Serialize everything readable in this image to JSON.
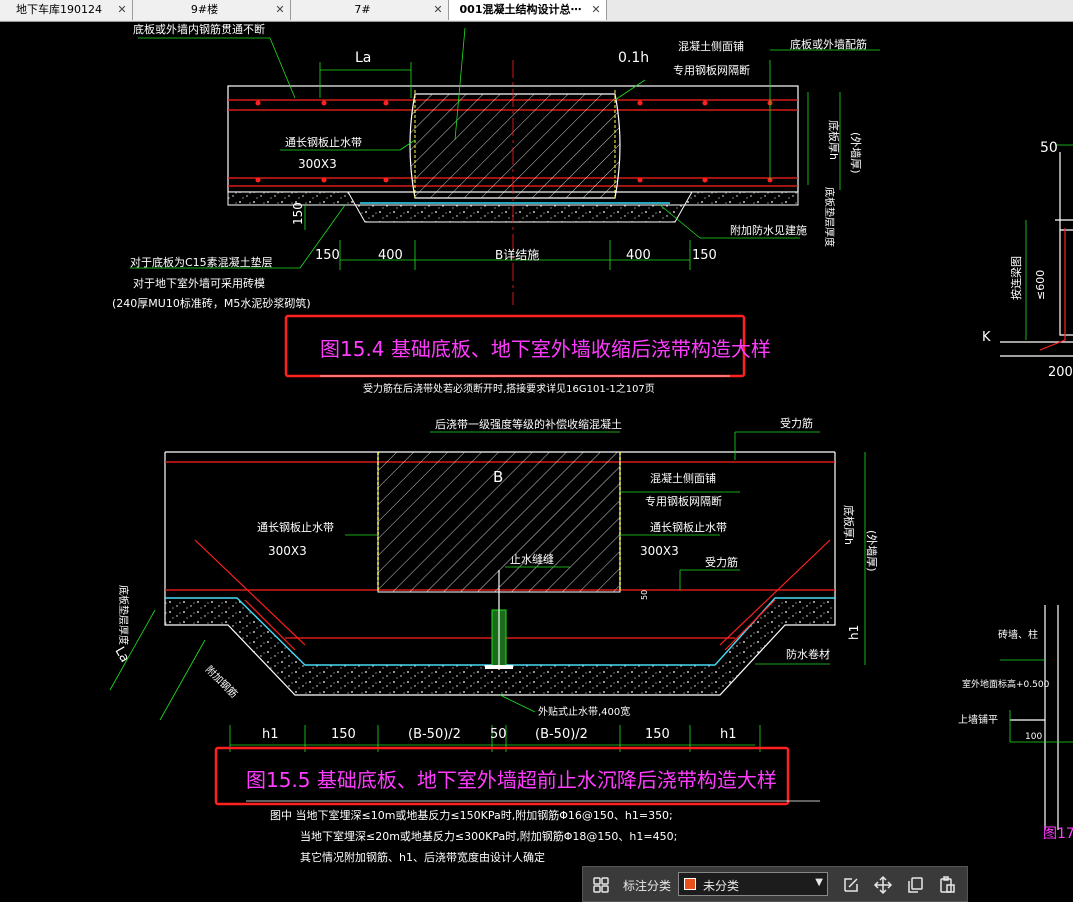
{
  "tabs": [
    {
      "label": "地下车库190124",
      "active": false
    },
    {
      "label": "9#楼",
      "active": false
    },
    {
      "label": "7#",
      "active": false
    },
    {
      "label": "001混凝土结构设计总⋯",
      "active": true
    }
  ],
  "tab_close_glyph": "✕",
  "drawing1": {
    "title": "图15.4  基础底板、地下室外墙收缩后浇带构造大样",
    "note_top": "底板或外墙内钢筋贯通不断",
    "La": "La",
    "dim_01h": "0.1h",
    "concrete_mesh": "混凝土侧面铺",
    "steel_mesh": "专用钢板网隔断",
    "wall_reinf": "底板或外墙配筋",
    "waterstop": "通长钢板止水带",
    "waterstop_size": "300X3",
    "thickness_label": "底板厚h",
    "wall_thickness": "(外墙厚)",
    "slab_strength": "底板垫层厚度",
    "extra_waterproof": "附加防水见建施",
    "dim_150_left": "150",
    "dim_150_right": "150",
    "dim_150_vert": "150",
    "dim_400_left": "400",
    "dim_400_right": "400",
    "dim_b": "B详结施",
    "note_c15": "对于底板为C15素混凝土垫层",
    "note_wall": "对于地下室外墙可采用砖模",
    "note_brick": "(240厚MU10标准砖，M5水泥砂浆砌筑)",
    "caption_note": "受力筋在后浇带处若必须断开时,搭接要求详见16G101-1之107页"
  },
  "drawing2": {
    "title": "图15.5  基础底板、地下室外墙超前止水沉降后浇带构造大样",
    "pour_note": "后浇带一级强度等级的补偿收缩混凝土",
    "stress_bar": "受力筋",
    "stress_bar2": "受力筋",
    "B": "B",
    "concrete_mesh": "混凝土侧面铺",
    "steel_mesh": "专用钢板网隔断",
    "waterstop_l": "通长钢板止水带",
    "waterstop_r": "通长钢板止水带",
    "size_l": "300X3",
    "size_r": "300X3",
    "waterstop_slit": "止水缝缝",
    "thickness_label": "底板厚h",
    "wall_thickness": "(外墙厚)",
    "h1_right": "h1",
    "waterproof": "防水卷材",
    "left_slab": "底板垫层厚度",
    "left_La": "La",
    "left_extra": "附加钢筋",
    "dim_50_small": "50",
    "ext_waterstop": "外贴式止水带,400宽",
    "dims": [
      "h1",
      "150",
      "(B-50)/2",
      "50",
      "(B-50)/2",
      "150",
      "h1"
    ],
    "note1": "图中  当地下室埋深≤10m或地基反力≤150KPa时,附加钢筋Φ16@150、h1=350;",
    "note2": "当地下室埋深≤20m或地基反力≤300KPa时,附加钢筋Φ18@150、h1=450;",
    "note3": "其它情况附加钢筋、h1、后浇带宽度由设计人确定"
  },
  "right_drawing": {
    "dim_50": "50",
    "top_label": "按连梁图",
    "le600": "≤600",
    "K": "K",
    "dim_200": "200",
    "wall_column": "砖墙、柱",
    "outdoor_level": "室外地面标高+0.500",
    "upper_flat": "上墙铺平",
    "dim_100": "100",
    "fig17": "图17"
  },
  "toolbar": {
    "label": "标注分类",
    "value": "未分类",
    "swatch_color": "#e8501e",
    "icons": [
      "grid-icon",
      "edit-icon",
      "move-icon",
      "copy-icon",
      "paste-icon"
    ]
  },
  "colors": {
    "magenta": "#ff3cff",
    "rebar_red": "#ff2020",
    "green": "#20e020",
    "cyan": "#30e0ff",
    "yellow": "#ffff40",
    "white": "#ffffff",
    "highlight": "#ff2020"
  }
}
